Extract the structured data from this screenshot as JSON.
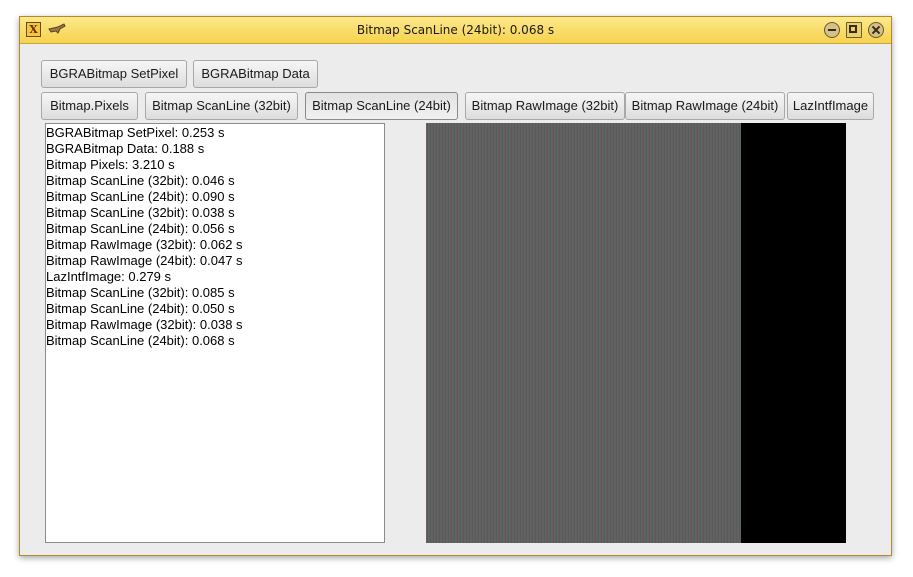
{
  "window": {
    "title": "Bitmap ScanLine (24bit): 0.068 s",
    "app_icon_glyph": "X"
  },
  "buttons_row1": [
    {
      "label": "BGRABitmap SetPixel"
    },
    {
      "label": "BGRABitmap Data"
    }
  ],
  "buttons_row2": [
    {
      "label": "Bitmap.Pixels"
    },
    {
      "label": "Bitmap ScanLine (32bit)"
    },
    {
      "label": "Bitmap ScanLine (24bit)"
    },
    {
      "label": "Bitmap RawImage (32bit)"
    },
    {
      "label": "Bitmap RawImage (24bit)"
    },
    {
      "label": "LazIntfImage"
    }
  ],
  "log": [
    "BGRABitmap SetPixel: 0.253 s",
    "BGRABitmap Data: 0.188 s",
    "Bitmap Pixels: 3.210 s",
    "Bitmap ScanLine (32bit): 0.046 s",
    "Bitmap ScanLine (24bit): 0.090 s",
    "Bitmap ScanLine (32bit): 0.038 s",
    "Bitmap ScanLine (24bit): 0.056 s",
    "Bitmap RawImage (32bit): 0.062 s",
    "Bitmap RawImage (24bit): 0.047 s",
    "LazIntfImage: 0.279 s",
    "Bitmap ScanLine (32bit): 0.085 s",
    "Bitmap ScanLine (24bit): 0.050 s",
    "Bitmap RawImage (32bit): 0.038 s",
    "Bitmap ScanLine (24bit): 0.068 s"
  ],
  "colors": {
    "titlebar": "#f6d24e",
    "stripe_gray": "#5a5a5a",
    "stripe_tint_a": "#6a5a6a",
    "stripe_tint_b": "#5a6a5a",
    "black": "#000000"
  }
}
